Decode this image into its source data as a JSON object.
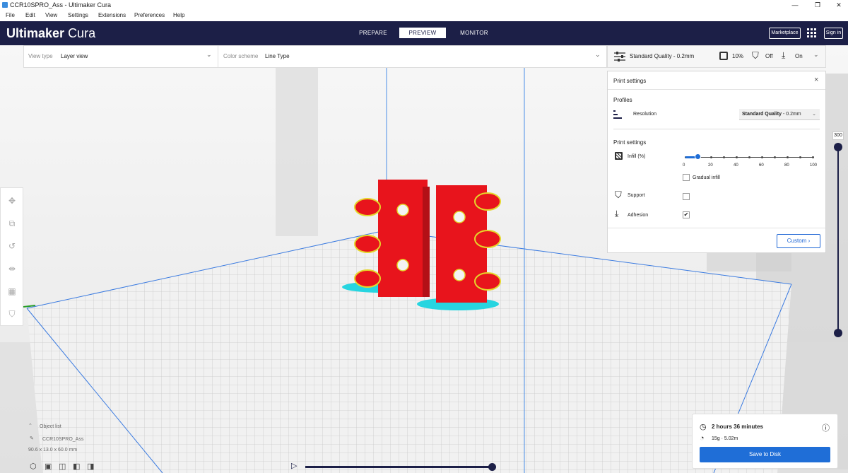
{
  "window": {
    "title": "CCR10SPRO_Ass - Ultimaker Cura",
    "controls": [
      "—",
      "❐",
      "✕"
    ]
  },
  "menu": [
    "File",
    "Edit",
    "View",
    "Settings",
    "Extensions",
    "Preferences",
    "Help"
  ],
  "header": {
    "logo_main": "Ultimaker",
    "logo_sub": "Cura",
    "stages": [
      "PREPARE",
      "PREVIEW",
      "MONITOR"
    ],
    "active_stage": "PREVIEW",
    "marketplace": "Marketplace",
    "signin": "Sign in"
  },
  "viewbar": {
    "view_type_label": "View type",
    "view_type_value": "Layer view",
    "color_scheme_label": "Color scheme",
    "color_scheme_value": "Line Type"
  },
  "quality": {
    "profile": "Standard Quality - 0.2mm",
    "infill": "10%",
    "support": "Off",
    "adhesion": "On"
  },
  "print_settings": {
    "title": "Print settings",
    "close": "×",
    "profiles_label": "Profiles",
    "resolution_label": "Resolution",
    "resolution_bold": "Standard Quality",
    "resolution_rest": " - 0.2mm",
    "section_label": "Print settings",
    "infill_label": "Infill (%)",
    "infill_value": 0.1,
    "infill_ticks": [
      "0",
      "20",
      "40",
      "60",
      "80",
      "100"
    ],
    "gradual_infill_label": "Gradual infill",
    "gradual_infill_checked": "",
    "support_label": "Support",
    "support_checked": "",
    "adhesion_label": "Adhesion",
    "adhesion_checked": "✔",
    "custom_button": "Custom"
  },
  "layer_slider": {
    "max_layer": "300"
  },
  "object_list": {
    "title": "Object list",
    "object_name": "CCR10SPRO_Ass",
    "dimensions": "90.6 x 13.0 x 60.0 mm"
  },
  "estimate": {
    "time": "2 hours 36 minutes",
    "material": "15g · 5.02m",
    "save_button": "Save to Disk"
  },
  "colors": {
    "header_bg": "#1c1f47",
    "accent_blue": "#1f6ed7",
    "model_red": "#e8141c",
    "skirt_cyan": "#27d5e0",
    "wall_yellow": "#e5d62a"
  }
}
